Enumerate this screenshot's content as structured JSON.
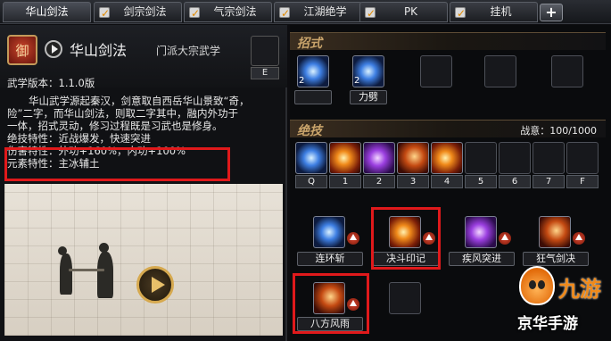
{
  "tabs": [
    {
      "label": "华山剑法",
      "checked": false,
      "active": true
    },
    {
      "label": "剑宗剑法",
      "checked": true,
      "active": false
    },
    {
      "label": "气宗剑法",
      "checked": true,
      "active": false
    },
    {
      "label": "江湖绝学",
      "checked": true,
      "active": false
    },
    {
      "label": "PK",
      "checked": true,
      "active": false
    },
    {
      "label": "挂机",
      "checked": true,
      "active": false
    }
  ],
  "add_tab_label": "+",
  "martial_art": {
    "emblem_char": "御",
    "title": "华山剑法",
    "category": "门派大宗武学",
    "slot_key": "E",
    "version": "武学版本：1.1.0版",
    "description_lines": [
      "华山武学源起秦汉，剑意取自西岳华山景致“奇，",
      "险”二字，而华山剑法，则取二字其中，融内外功于",
      "一体，招式灵动，修习过程既是习武也是修身。"
    ],
    "traits": {
      "skill": "绝技特性：近战爆发，快速突进",
      "damage": "伤害特性：外功+160%，内功+100%",
      "element": "元素特性：主冰辅土"
    }
  },
  "moves": {
    "title": "招式",
    "slots": [
      {
        "count": "2",
        "label": "",
        "icon": "blue-slash"
      },
      {
        "count": "2",
        "label": "力劈",
        "icon": "blue-slash"
      },
      {
        "count": "",
        "label": "",
        "icon": "empty"
      },
      {
        "count": "",
        "label": "",
        "icon": "empty"
      },
      {
        "count": "",
        "label": "",
        "icon": "empty"
      }
    ]
  },
  "ultimates": {
    "title": "绝技",
    "fight_power": "战意：100/1000",
    "hotbar": [
      {
        "key": "Q",
        "icon": "blue-slash"
      },
      {
        "key": "1",
        "icon": "fire-sword"
      },
      {
        "key": "2",
        "icon": "purple-sword"
      },
      {
        "key": "3",
        "icon": "fire-dash"
      },
      {
        "key": "4",
        "icon": "fire-blade"
      },
      {
        "key": "5",
        "icon": "empty"
      },
      {
        "key": "6",
        "icon": "empty"
      },
      {
        "key": "7",
        "icon": "empty"
      },
      {
        "key": "F",
        "icon": "empty"
      }
    ],
    "skills": [
      {
        "name": "连环斩",
        "icon": "blue-slash",
        "upgradable": true
      },
      {
        "name": "决斗印记",
        "icon": "fire-sword",
        "upgradable": true
      },
      {
        "name": "疾风突进",
        "icon": "purple-sword",
        "upgradable": true
      },
      {
        "name": "狂气剑决",
        "icon": "fire-blade",
        "upgradable": true
      },
      {
        "name": "八方风雨",
        "icon": "fire-swirl",
        "upgradable": true
      }
    ]
  },
  "watermark": {
    "logo_text": "九游",
    "site_text": "京华手游"
  }
}
